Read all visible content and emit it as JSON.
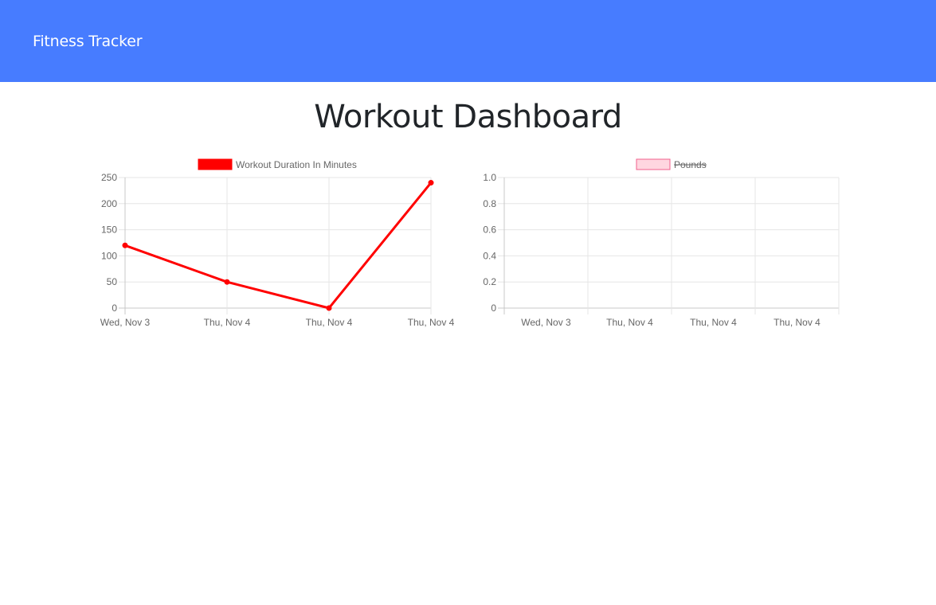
{
  "navbar": {
    "brand": "Fitness Tracker"
  },
  "page": {
    "title": "Workout Dashboard"
  },
  "colors": {
    "navbar_bg": "#477cff",
    "duration_line": "#ff0000",
    "pounds_fill": "#ffd6e0",
    "pounds_stroke": "#f0608c"
  },
  "chart_data": [
    {
      "type": "line",
      "categories": [
        "Wed, Nov 3",
        "Thu, Nov 4",
        "Thu, Nov 4",
        "Thu, Nov 4"
      ],
      "series": [
        {
          "name": "Workout Duration In Minutes",
          "values": [
            120,
            50,
            0,
            240
          ]
        }
      ],
      "yticks": [
        "0",
        "50",
        "100",
        "150",
        "200",
        "250"
      ],
      "ylim": [
        0,
        250
      ],
      "legend": "top-center",
      "grid": true
    },
    {
      "type": "bar",
      "categories": [
        "Wed, Nov 3",
        "Thu, Nov 4",
        "Thu, Nov 4",
        "Thu, Nov 4"
      ],
      "series": [
        {
          "name": "Pounds",
          "values": [],
          "hidden": true
        }
      ],
      "yticks": [
        "0",
        "0.2",
        "0.4",
        "0.6",
        "0.8",
        "1.0"
      ],
      "ylim": [
        0,
        1
      ],
      "legend": "top-center",
      "grid": true
    }
  ]
}
